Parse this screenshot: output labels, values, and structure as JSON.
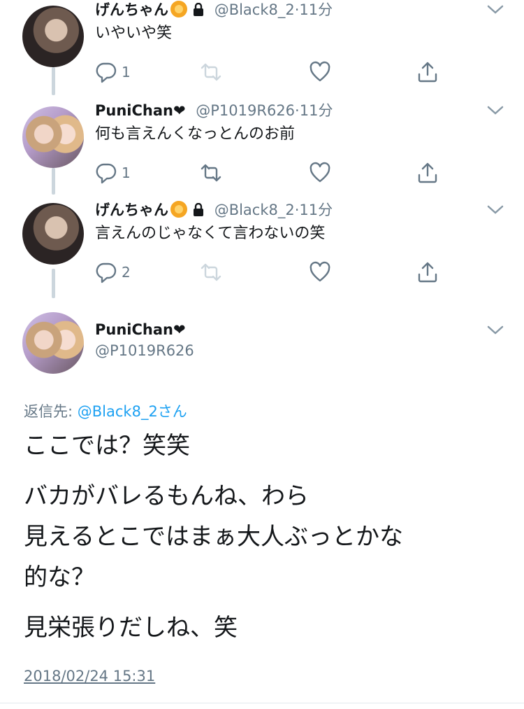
{
  "thread": [
    {
      "name": "げんちゃん",
      "has_emoji": true,
      "locked": true,
      "handle": "@Black8_2",
      "time": "11分",
      "text": "いやいや笑",
      "reply_count": "1"
    },
    {
      "name": "PuniChan❤",
      "has_emoji": false,
      "locked": false,
      "handle": "@P1019R626",
      "time": "11分",
      "text": "何も言えんくなっとんのお前",
      "reply_count": "1"
    },
    {
      "name": "げんちゃん",
      "has_emoji": true,
      "locked": true,
      "handle": "@Black8_2",
      "time": "11分",
      "text": "言えんのじゃなくて言わないの笑",
      "reply_count": "2"
    }
  ],
  "main": {
    "name": "PuniChan❤",
    "handle": "@P1019R626",
    "reply_label": "返信先:",
    "reply_target": "@Black8_2さん",
    "lines": [
      "ここでは？笑笑",
      "バカがバレるもんね、わら",
      "見えるとこではまぁ大人ぶっとかな",
      "的な？",
      "見栄張りだしね、笑"
    ],
    "timestamp": "2018/02/24 15:31"
  },
  "separator": "·",
  "icons": {
    "reply": "reply-icon",
    "retweet": "retweet-icon",
    "like": "heart-icon",
    "share": "share-icon",
    "caret": "chevron-down-icon",
    "lock": "lock-icon"
  }
}
